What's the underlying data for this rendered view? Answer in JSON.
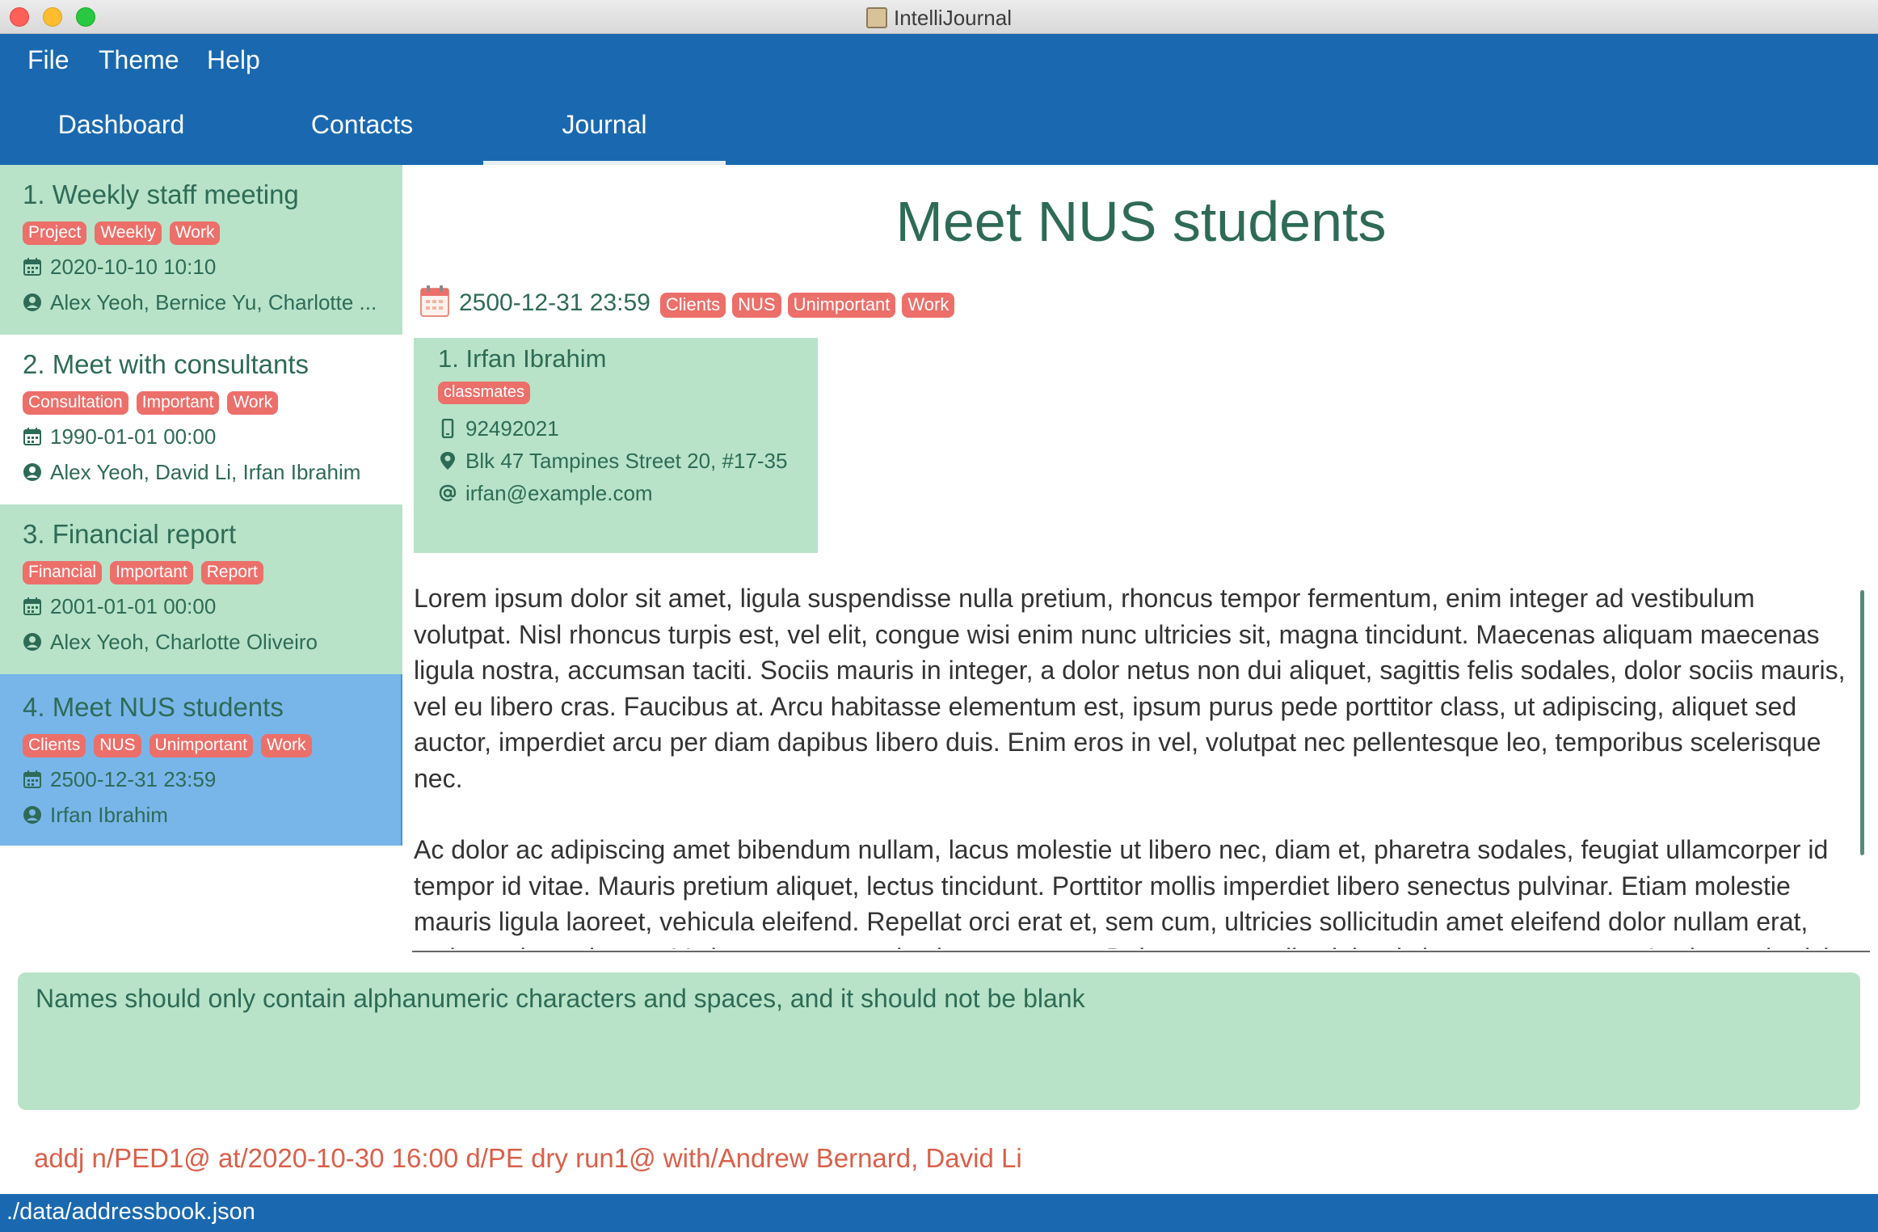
{
  "window": {
    "title": "IntelliJournal"
  },
  "menu": {
    "items": [
      "File",
      "Theme",
      "Help"
    ]
  },
  "tabs": [
    {
      "label": "Dashboard",
      "active": false
    },
    {
      "label": "Contacts",
      "active": false
    },
    {
      "label": "Journal",
      "active": true
    }
  ],
  "entries": [
    {
      "title": "1.  Weekly staff meeting",
      "tags": [
        "Project",
        "Weekly",
        "Work"
      ],
      "datetime": "2020-10-10 10:10",
      "contacts": "Alex Yeoh, Bernice Yu, Charlotte ..."
    },
    {
      "title": "2.  Meet with consultants",
      "tags": [
        "Consultation",
        "Important",
        "Work"
      ],
      "datetime": "1990-01-01 00:00",
      "contacts": "Alex Yeoh, David Li, Irfan Ibrahim"
    },
    {
      "title": "3.  Financial report",
      "tags": [
        "Financial",
        "Important",
        "Report"
      ],
      "datetime": "2001-01-01 00:00",
      "contacts": "Alex Yeoh, Charlotte Oliveiro"
    },
    {
      "title": "4.  Meet NUS students",
      "tags": [
        "Clients",
        "NUS",
        "Unimportant",
        "Work"
      ],
      "datetime": "2500-12-31 23:59",
      "contacts": "Irfan Ibrahim"
    }
  ],
  "selected_entry_index": 3,
  "detail": {
    "title": "Meet NUS students",
    "datetime": "2500-12-31 23:59",
    "tags": [
      "Clients",
      "NUS",
      "Unimportant",
      "Work"
    ],
    "contact": {
      "name": "1.  Irfan Ibrahim",
      "tags": [
        "classmates"
      ],
      "phone": "92492021",
      "address": "Blk 47 Tampines Street 20, #17-35",
      "email": "irfan@example.com"
    },
    "description": [
      "Lorem ipsum dolor sit amet, ligula suspendisse nulla pretium, rhoncus tempor fermentum, enim integer ad vestibulum volutpat. Nisl rhoncus turpis est, vel elit, congue wisi enim nunc ultricies sit, magna tincidunt. Maecenas aliquam maecenas ligula nostra, accumsan taciti. Sociis mauris in integer, a dolor netus non dui aliquet, sagittis felis sodales, dolor sociis mauris, vel eu libero cras. Faucibus at. Arcu habitasse elementum est, ipsum purus pede porttitor class, ut adipiscing, aliquet sed auctor, imperdiet arcu per diam dapibus libero duis. Enim eros in vel, volutpat nec pellentesque leo, temporibus scelerisque nec.",
      "Ac dolor ac adipiscing amet bibendum nullam, lacus molestie ut libero nec, diam et, pharetra sodales, feugiat ullamcorper id tempor id vitae. Mauris pretium aliquet, lectus tincidunt. Porttitor mollis imperdiet libero senectus pulvinar. Etiam molestie mauris ligula laoreet, vehicula eleifend. Repellat orci erat et, sem cum, ultricies sollicitudin amet eleifend dolor nullam erat, malesuada est leo ac. Varius natoque turpis elementum est. Duis montes, tellus lobortis lacus amet arcu et. In vitae vel, wisi"
    ]
  },
  "result": {
    "message": "Names should only contain alphanumeric characters and spaces, and it should not be blank"
  },
  "command": {
    "value": "addj n/PED1@ at/2020-10-30 16:00 d/PE dry run1@ with/Andrew Bernard, David Li"
  },
  "status": {
    "path": "./data/addressbook.json"
  },
  "colors": {
    "primary": "#1a69b0",
    "card": "#b8e3c8",
    "selected": "#78b6ea",
    "tag": "#ec6f6a",
    "text": "#2e6b57",
    "command": "#d9604a"
  }
}
